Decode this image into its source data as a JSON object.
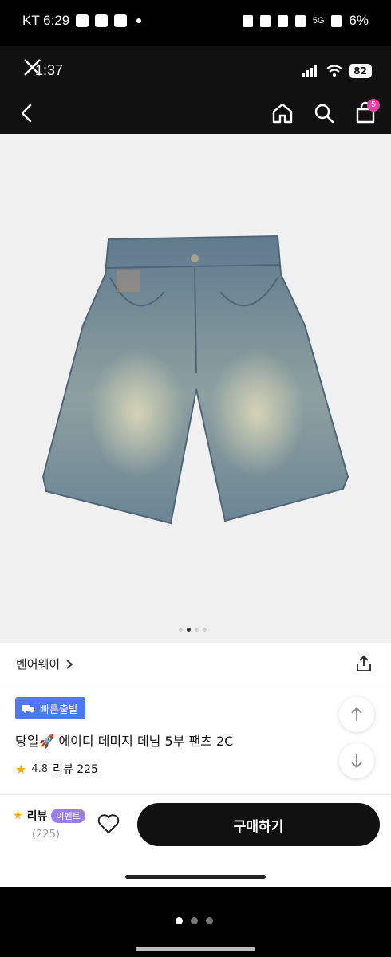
{
  "outer_status": {
    "carrier_time": "KT 6:29",
    "battery": "6%",
    "network": "5G"
  },
  "inner_status": {
    "time": "1:37",
    "battery": "82"
  },
  "nav": {
    "cart_count": "5"
  },
  "carousel": {
    "total": 4,
    "active_index": 1
  },
  "brand": {
    "name": "벤어웨이"
  },
  "product": {
    "fast_badge": "빠른출발",
    "title": "당일🚀 에이디 데미지 데님 5부 팬츠 2C",
    "rating": "4.8",
    "review_label": "리뷰 225"
  },
  "bottom": {
    "review_label": "리뷰",
    "event_label": "이벤트",
    "review_count": "(225)",
    "buy_label": "구매하기"
  },
  "colors": {
    "accent_blue": "#4d78f2",
    "event_purple": "#9c7cf3",
    "badge_pink": "#e83ea8",
    "star": "#f4a623"
  }
}
